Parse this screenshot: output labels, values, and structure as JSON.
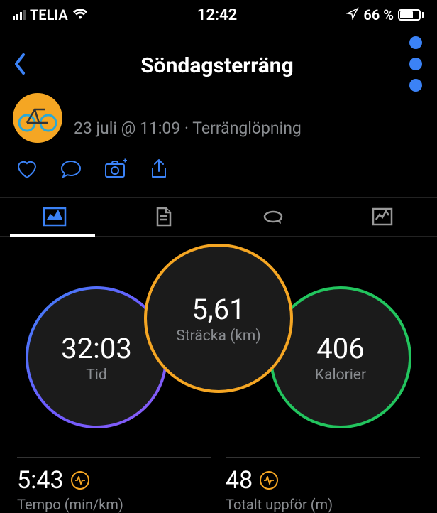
{
  "status": {
    "carrier": "TELIA",
    "time": "12:42",
    "battery_pct": "66 %"
  },
  "nav": {
    "title": "Söndagsterräng"
  },
  "activity": {
    "meta": "23 juli @ 11:09 · Terränglöpning"
  },
  "circles": {
    "distance": {
      "value": "5,61",
      "label": "Sträcka (km)"
    },
    "time": {
      "value": "32:03",
      "label": "Tid"
    },
    "calories": {
      "value": "406",
      "label": "Kalorier"
    }
  },
  "stats": {
    "pace": {
      "value": "5:43",
      "label": "Tempo (min/km)"
    },
    "ascent": {
      "value": "48",
      "label": "Totalt uppför (m)"
    }
  }
}
